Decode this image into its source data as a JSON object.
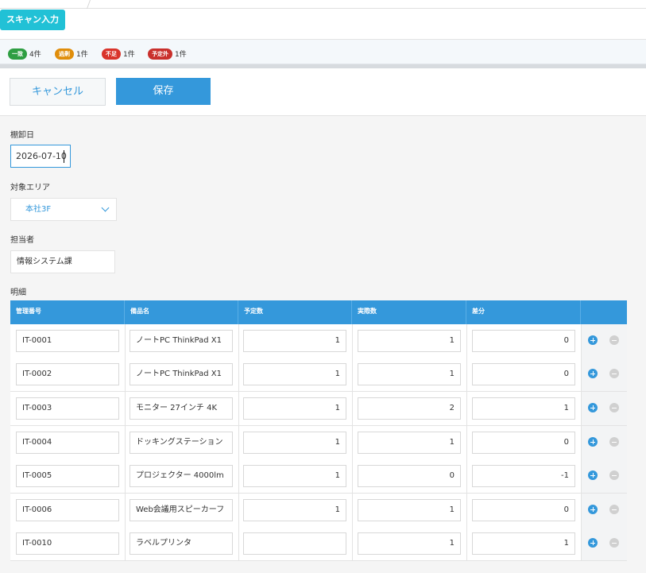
{
  "toolbar": {
    "scan_label": "スキャン入力"
  },
  "summary": [
    {
      "label": "一致",
      "count": "4件",
      "color": "#2e9e42"
    },
    {
      "label": "過剰",
      "count": "1件",
      "color": "#e08e0b"
    },
    {
      "label": "不足",
      "count": "1件",
      "color": "#d9342b"
    },
    {
      "label": "予定外",
      "count": "1件",
      "color": "#c9302c"
    }
  ],
  "actions": {
    "cancel_label": "キャンセル",
    "save_label": "保存"
  },
  "form": {
    "date_label": "棚卸日",
    "date_value": "2026-07-10",
    "area_label": "対象エリア",
    "area_value": "本社3F",
    "owner_label": "担当者",
    "owner_value": "情報システム課",
    "detail_label": "明細"
  },
  "table": {
    "headers": [
      "管理番号",
      "備品名",
      "予定数",
      "実際数",
      "差分"
    ],
    "rows": [
      {
        "id": "IT-0001",
        "name": "ノートPC ThinkPad X1",
        "planned": "1",
        "actual": "1",
        "diff": "0"
      },
      {
        "id": "IT-0002",
        "name": "ノートPC ThinkPad X1",
        "planned": "1",
        "actual": "1",
        "diff": "0"
      },
      {
        "id": "IT-0003",
        "name": "モニター 27インチ 4K",
        "planned": "1",
        "actual": "2",
        "diff": "1"
      },
      {
        "id": "IT-0004",
        "name": "ドッキングステーション",
        "planned": "1",
        "actual": "1",
        "diff": "0"
      },
      {
        "id": "IT-0005",
        "name": "プロジェクター 4000lm",
        "planned": "1",
        "actual": "0",
        "diff": "-1"
      },
      {
        "id": "IT-0006",
        "name": "Web会議用スピーカーフ",
        "planned": "1",
        "actual": "1",
        "diff": "0"
      },
      {
        "id": "IT-0010",
        "name": "ラベルプリンタ",
        "planned": "",
        "actual": "1",
        "diff": "1"
      }
    ]
  }
}
